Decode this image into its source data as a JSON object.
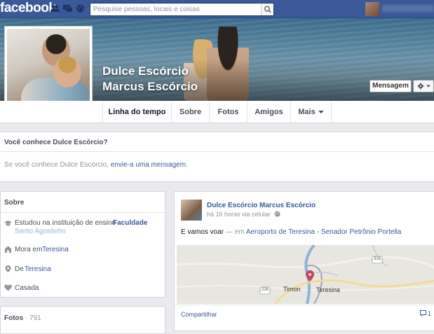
{
  "topbar": {
    "logo": "facebook",
    "search_placeholder": "Pesquise pessoas, locais e coisas",
    "user_name": ""
  },
  "profile": {
    "name_line1": "Dulce Escórcio",
    "name_line2": "Marcus Escórcio",
    "message_button": "Mensagem"
  },
  "nav": {
    "items": [
      "Linha do tempo",
      "Sobre",
      "Fotos",
      "Amigos",
      "Mais"
    ]
  },
  "knows": {
    "title": "Você conhece Dulce Escórcio?",
    "text_prefix": "Se você conhece Dulce Escórcio, ",
    "link": "envie-a uma mensagem",
    "text_suffix": "."
  },
  "about": {
    "title": "Sobre",
    "studied_prefix": "Estudou na instituição de ensino ",
    "studied_school": "Faculdade",
    "studied_school_line2": "Santo Agostinho",
    "lives_prefix": "Mora em ",
    "lives_city": "Teresina",
    "from_prefix": "De ",
    "from_city": "Teresina",
    "relationship": "Casada"
  },
  "photos": {
    "label": "Fotos",
    "count": "· 791"
  },
  "post": {
    "author": "Dulce Escórcio Marcus Escórcio",
    "meta": "há 16 horas via celular",
    "text": "E vamos voar",
    "at": " — em ",
    "place": "Aeroporto de Teresina - Senador Petrônio Portella",
    "map_labels": {
      "city1": "Timon",
      "city2": "Teresina",
      "road1": "226",
      "road2": "316"
    },
    "share": "Compartilhar",
    "comment_count": "1"
  },
  "colors": {
    "brand": "#3b5998",
    "link": "#3b5998",
    "background": "#e9eaed"
  }
}
